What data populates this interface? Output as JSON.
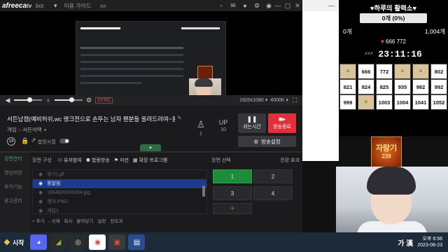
{
  "app": {
    "logo_main": "afreeca",
    "logo_tld": "tv",
    "logo_suffix": "bot",
    "menu_guide": "이용 가이드"
  },
  "controls": {
    "volume_level": 0.55,
    "mic_level": 0.6,
    "sync_label": "SYNC",
    "resolution": "1920x1080",
    "bitrate": "4000K"
  },
  "broadcast": {
    "title": "서든남캠(예비허쉬,wc 랭크전으로 손뚜는 남자 팬분들 올려드려여~꿀...",
    "category_parent": "게임",
    "category": "서든어택",
    "age_badge": "19",
    "hashtag_label": "합방사절",
    "viewers_count": "1",
    "up_label": "UP",
    "up_count": "10",
    "pause_label": "쉬는시간",
    "end_label": "방송종료",
    "settings_label": "방송설정"
  },
  "left_menu": [
    "장면관리",
    "영상저장",
    "부가기능",
    "광고관리"
  ],
  "scene_tools": {
    "title": "장면 구성",
    "tools": [
      "유저참여",
      "합동방송",
      "미션",
      "확장 프로그램"
    ]
  },
  "sources": [
    {
      "name": "왕기).gif",
      "selected": false
    },
    {
      "name": "몽알림",
      "selected": true
    },
    {
      "name": "1664920003284.jpg",
      "selected": false
    },
    {
      "name": "캠처.PNG",
      "selected": false
    },
    {
      "name": "게임1",
      "selected": false
    }
  ],
  "source_actions": [
    "+ 추가",
    "- 삭제",
    "복사",
    "붙여넣기",
    "설정",
    "전효과"
  ],
  "scene_select": {
    "title": "장면 선택",
    "transition": "전환 효과",
    "scenes": [
      "1",
      "2",
      "3",
      "4"
    ],
    "active": "1",
    "add_label": "+"
  },
  "overlay": {
    "title": "♥하루의 활력소♥",
    "progress_text": "0개 (0%)",
    "progress_fraction": 0,
    "min_label": "0개",
    "max_label": "1,004개",
    "gift_heart": "♥",
    "gift_value": "666 772",
    "timer_deco_left": "ᐟᐟᐟ",
    "timer": "23:11:16",
    "grid_row1": [
      "",
      "666",
      "772",
      "",
      "",
      "802"
    ],
    "grid_row2": [
      "821",
      "824",
      "825",
      "935",
      "982",
      "992"
    ],
    "grid_row3": [
      "999",
      "",
      "1003",
      "1004",
      "1041",
      "1052"
    ],
    "badge_top": "자랑기",
    "badge_bottom": "239"
  },
  "taskbar": {
    "start_label": "시작",
    "ime_label": "가 漢",
    "time": "오후 6:56",
    "date": "2023-08-23"
  },
  "colors": {
    "end_button": "#e0303a",
    "scene_active": "#1e8c3a",
    "source_selected": "#1e3a8f"
  }
}
